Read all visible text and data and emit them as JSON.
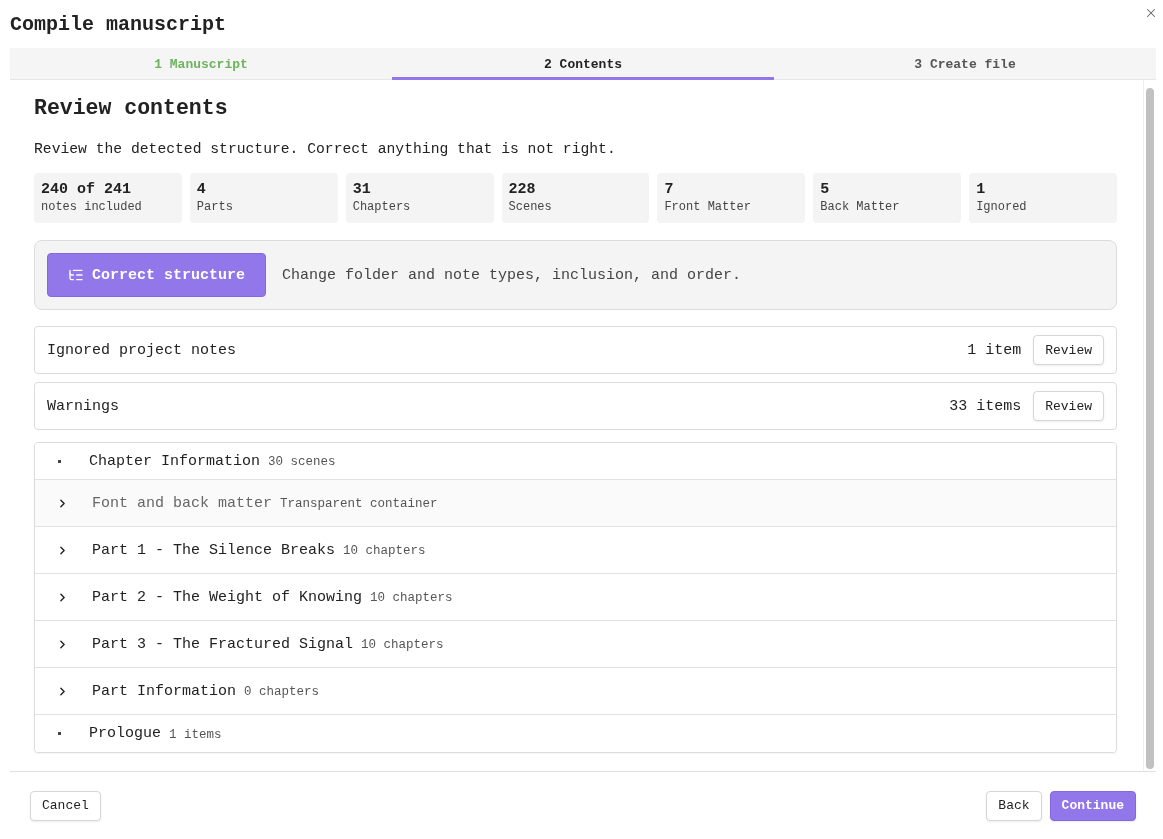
{
  "dialog": {
    "title": "Compile manuscript"
  },
  "steps": [
    {
      "label": "1 Manuscript",
      "selected": false,
      "completed": true
    },
    {
      "label": "2 Contents",
      "selected": true,
      "completed": false
    },
    {
      "label": "3 Create file",
      "selected": false,
      "completed": false
    }
  ],
  "content": {
    "heading": "Review contents",
    "description": "Review the detected structure. Correct anything that is not right.",
    "stats": [
      {
        "value": "240 of 241",
        "label": "notes included"
      },
      {
        "value": "4",
        "label": "Parts"
      },
      {
        "value": "31",
        "label": "Chapters"
      },
      {
        "value": "228",
        "label": "Scenes"
      },
      {
        "value": "7",
        "label": "Front Matter"
      },
      {
        "value": "5",
        "label": "Back Matter"
      },
      {
        "value": "1",
        "label": "Ignored"
      }
    ],
    "structure": {
      "button": "Correct structure",
      "hint": "Change folder and note types, inclusion, and order."
    },
    "checks": [
      {
        "label": "Ignored project notes",
        "count": "1 item",
        "action": "Review"
      },
      {
        "label": "Warnings",
        "count": "33 items",
        "action": "Review"
      }
    ],
    "tree": [
      {
        "kind": "leaf",
        "title": "Chapter Information",
        "meta": "30 scenes",
        "disabled": false
      },
      {
        "kind": "group",
        "title": "Font and back matter",
        "meta": "Transparent container",
        "disabled": true,
        "expanded": false
      },
      {
        "kind": "group",
        "title": "Part 1 - The Silence Breaks",
        "meta": "10 chapters",
        "disabled": false,
        "expanded": false
      },
      {
        "kind": "group",
        "title": "Part 2 - The Weight of Knowing",
        "meta": "10 chapters",
        "disabled": false,
        "expanded": false
      },
      {
        "kind": "group",
        "title": "Part 3 - The Fractured Signal",
        "meta": "10 chapters",
        "disabled": false,
        "expanded": false
      },
      {
        "kind": "group",
        "title": "Part Information",
        "meta": "0 chapters",
        "disabled": false,
        "expanded": false
      },
      {
        "kind": "leaf",
        "title": "Prologue",
        "meta": "1 items",
        "disabled": false
      }
    ]
  },
  "footer": {
    "left": [
      {
        "label": "Cancel",
        "kind": "secondary"
      }
    ],
    "right": [
      {
        "label": "Back",
        "kind": "secondary"
      },
      {
        "label": "Continue",
        "kind": "primary"
      }
    ]
  }
}
